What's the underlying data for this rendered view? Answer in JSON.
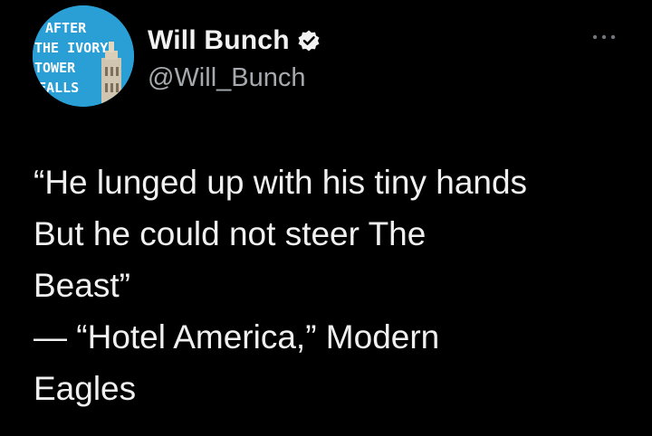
{
  "author": {
    "display_name": "Will Bunch",
    "handle": "@Will_Bunch",
    "verified_icon": "verified-badge-icon",
    "avatar": {
      "lines": [
        "AFTER",
        "THE IVORY",
        "TOWER",
        "FALLS"
      ],
      "background": "#2a9fd6"
    }
  },
  "more_icon": "ellipsis-icon",
  "tweet": {
    "lines": [
      "“He lunged up with his tiny hands",
      "But he could not steer The",
      "Beast”",
      "— “Hotel America,” Modern",
      "Eagles"
    ]
  },
  "colors": {
    "background": "#000000",
    "text": "#f0f0f0",
    "secondary_text": "#a6a9ad"
  }
}
